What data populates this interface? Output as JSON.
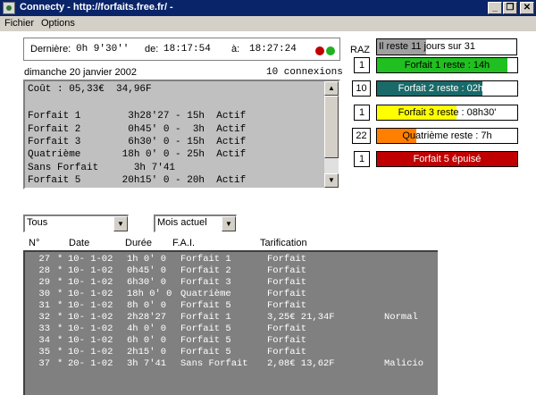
{
  "window": {
    "title": "Connecty - http://forfaits.free.fr/ -",
    "min_glyph": "_",
    "max_glyph": "❐",
    "close_glyph": "✕"
  },
  "menu": {
    "items": [
      "Fichier",
      "Options"
    ]
  },
  "times": {
    "last_label": "Dernière:",
    "last_value": "0h 9'30''",
    "from_label": "de:",
    "from_value": "18:17:54",
    "to_label": "à:",
    "to_value": "18:27:24",
    "status_colors": [
      "#c00000",
      "#20b020"
    ]
  },
  "date_text": "dimanche 20 janvier 2002",
  "connections_text": "10 connexions",
  "summary_lines": [
    "Coût : 05,33€  34,96F",
    "",
    "Forfait 1        3h28'27 - 15h  Actif",
    "Forfait 2        0h45' 0 -  3h  Actif",
    "Forfait 3        6h30' 0 - 15h  Actif",
    "Quatrième       18h 0' 0 - 25h  Actif",
    "Sans Forfait      3h 7'41",
    "Forfait 5       20h15' 0 - 20h  Actif"
  ],
  "raz": {
    "label": "RAZ",
    "items": [
      {
        "value": "1",
        "text": "Il reste 11 jours sur 31",
        "color": "#a0a0a0",
        "fill": 0.35
      },
      {
        "value": "1",
        "text": "Forfait 1 reste : 14h",
        "color": "#20c020",
        "fill": 0.93
      },
      {
        "value": "10",
        "text": "Forfait 2 reste : 02h15'",
        "color": "#1a6a6a",
        "fill": 0.75
      },
      {
        "value": "1",
        "text": "Forfait 3 reste : 08h30'",
        "color": "#ffff00",
        "fill": 0.57
      },
      {
        "value": "22",
        "text": "Quatrième reste : 7h",
        "color": "#ff8000",
        "fill": 0.28
      },
      {
        "value": "1",
        "text": "Forfait 5 épuisé",
        "color": "#c00000",
        "fill": 1.0
      }
    ]
  },
  "filters": {
    "category": "Tous",
    "period": "Mois actuel"
  },
  "table": {
    "headers": [
      "N°",
      "Date",
      "Durée",
      "F.A.I.",
      "Tarification"
    ],
    "rows": [
      [
        "27",
        "*",
        "10- 1-02",
        "1h 0' 0",
        "Forfait 1",
        "Forfait",
        ""
      ],
      [
        "28",
        "*",
        "10- 1-02",
        "0h45' 0",
        "Forfait 2",
        "Forfait",
        ""
      ],
      [
        "29",
        "*",
        "10- 1-02",
        "6h30' 0",
        "Forfait 3",
        "Forfait",
        ""
      ],
      [
        "30",
        "*",
        "10- 1-02",
        "18h 0' 0",
        "Quatrième",
        "Forfait",
        ""
      ],
      [
        "31",
        "*",
        "10- 1-02",
        "8h 0' 0",
        "Forfait 5",
        "Forfait",
        ""
      ],
      [
        "32",
        "*",
        "10- 1-02",
        "2h28'27",
        "Forfait 1",
        "3,25€ 21,34F",
        "Normal"
      ],
      [
        "33",
        "*",
        "10- 1-02",
        "4h 0' 0",
        "Forfait 5",
        "Forfait",
        ""
      ],
      [
        "34",
        "*",
        "10- 1-02",
        "6h 0' 0",
        "Forfait 5",
        "Forfait",
        ""
      ],
      [
        "35",
        "*",
        "10- 1-02",
        "2h15' 0",
        "Forfait 5",
        "Forfait",
        ""
      ],
      [
        "37",
        "*",
        "20- 1-02",
        "3h 7'41",
        "Sans Forfait",
        "2,08€ 13,62F",
        "Malicio"
      ]
    ]
  }
}
